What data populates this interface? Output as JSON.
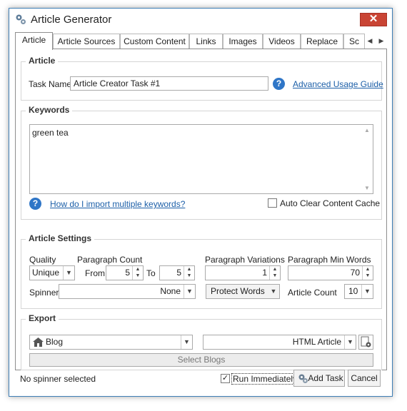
{
  "window": {
    "title": "Article Generator",
    "close": "✕"
  },
  "tabs": [
    "Article",
    "Article Sources",
    "Custom Content",
    "Links",
    "Images",
    "Videos",
    "Replace",
    "Sc"
  ],
  "tab_arrows": {
    "left": "◀",
    "right": "▶"
  },
  "article_group": {
    "title": "Article",
    "task_name_label": "Task Name",
    "task_name_value": "Article Creator Task #1",
    "help": "?",
    "guide_link": "Advanced Usage Guide"
  },
  "keywords_group": {
    "title": "Keywords",
    "keywords_value": "green tea",
    "scroll_up": "▲",
    "scroll_down": "▼",
    "import_link": "How do I import multiple keywords?",
    "help": "?",
    "auto_clear_label": "Auto Clear Content Cache"
  },
  "settings_group": {
    "title": "Article Settings",
    "quality_label": "Quality",
    "quality_value": "Unique",
    "paragraph_count_label": "Paragraph Count",
    "from_label": "From",
    "from_value": "5",
    "to_label": "To",
    "to_value": "5",
    "variations_label": "Paragraph Variations",
    "variations_value": "1",
    "min_words_label": "Paragraph Min Words",
    "min_words_value": "70",
    "spinner_label": "Spinner",
    "spinner_value": "None",
    "protect_words": "Protect Words",
    "article_count_label": "Article Count",
    "article_count_value": "10",
    "spin_arrows": "▲\n▼",
    "drop_arrow": "▼"
  },
  "export_group": {
    "title": "Export",
    "target_value": "Blog",
    "format_value": "HTML Article",
    "select_blogs": "Select Blogs"
  },
  "footer": {
    "status": "No spinner selected",
    "run_immediately": "Run Immediately",
    "run_checked": "✓",
    "add_task": "Add Task",
    "cancel": "Cancel"
  }
}
